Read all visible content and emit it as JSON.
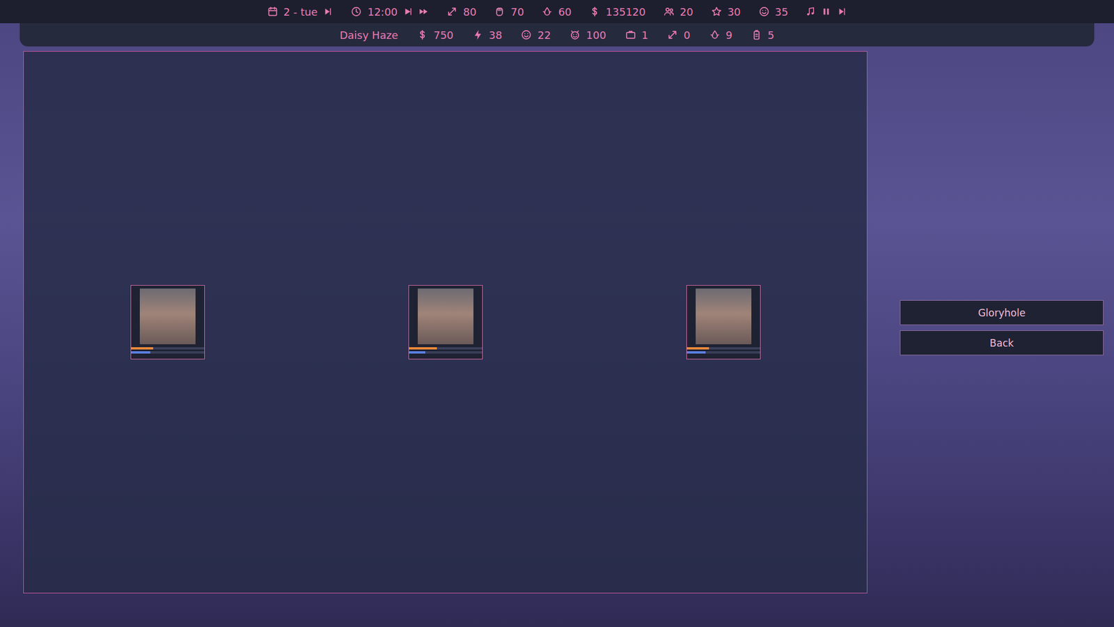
{
  "top_bar": {
    "day": "2 - tue",
    "time": "12:00",
    "stats": [
      "80",
      "70",
      "60",
      "135120",
      "20",
      "30",
      "35"
    ]
  },
  "character": {
    "name": "Daisy Haze",
    "stats": [
      "750",
      "38",
      "22",
      "100",
      "1",
      "0",
      "9",
      "5"
    ]
  },
  "girls": [
    {
      "bars": [
        {
          "level": 0.3,
          "color": "#e8883a"
        },
        {
          "level": 0.26,
          "color": "#5b7fe0"
        }
      ]
    },
    {
      "bars": [
        {
          "level": 0.38,
          "color": "#e8883a"
        },
        {
          "level": 0.22,
          "color": "#5b7fe0"
        }
      ]
    },
    {
      "bars": [
        {
          "level": 0.3,
          "color": "#e8883a"
        },
        {
          "level": 0.25,
          "color": "#5b7fe0"
        }
      ]
    }
  ],
  "buttons": [
    {
      "label": "Gloryhole"
    },
    {
      "label": "Back"
    }
  ]
}
